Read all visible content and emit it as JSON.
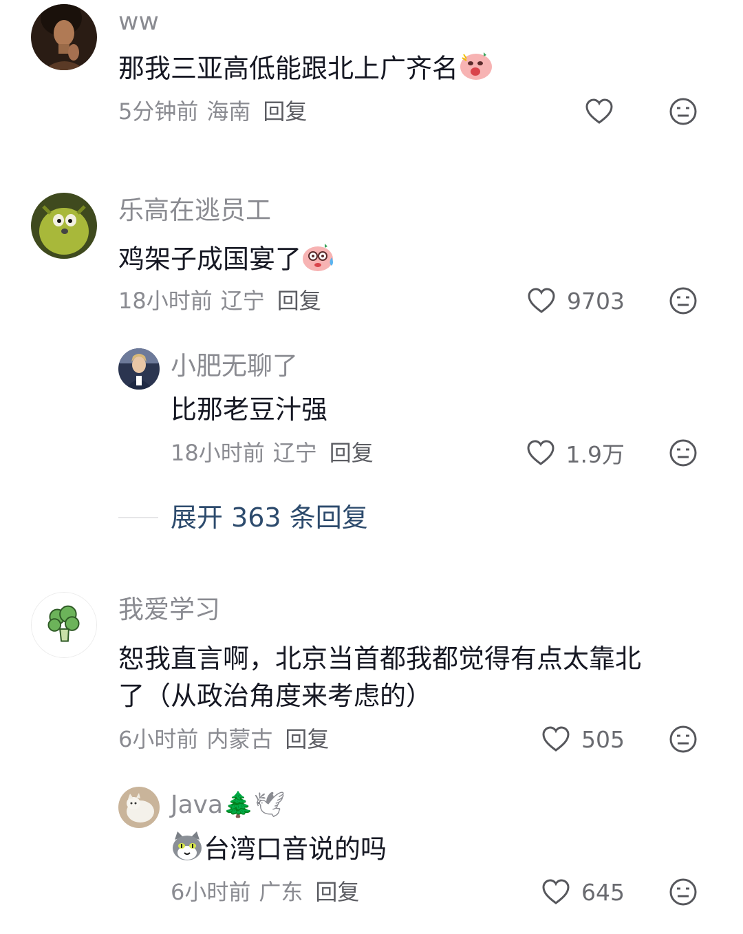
{
  "comments": [
    {
      "username": "ww",
      "text": "那我三亚高低能跟北上广齐名",
      "time": "5分钟前",
      "location": "海南",
      "reply_label": "回复",
      "likes": "",
      "avatar_icon": "woman-portrait-dark",
      "text_emoji": "angry-pig-emoji"
    },
    {
      "username": "乐高在逃员工",
      "text": "鸡架子成国宴了",
      "time": "18小时前",
      "location": "辽宁",
      "reply_label": "回复",
      "likes": "9703",
      "avatar_icon": "green-creature",
      "text_emoji": "sweat-pig-emoji",
      "replies": [
        {
          "username": "小肥无聊了",
          "text": "比那老豆汁强",
          "time": "18小时前",
          "location": "辽宁",
          "reply_label": "回复",
          "likes": "1.9万",
          "avatar_icon": "person-photo"
        }
      ],
      "expand_label": "展开 363 条回复"
    },
    {
      "username": "我爱学习",
      "text_line1": "恕我直言啊，北京当首都我都觉得有点太靠北",
      "text_line2": "了（从政治角度来考虑的）",
      "time": "6小时前",
      "location": "内蒙古",
      "reply_label": "回复",
      "likes": "505",
      "avatar_icon": "broccoli",
      "replies": [
        {
          "username": "Java",
          "username_emojis": "🌲🕊",
          "text": "台湾口音说的吗",
          "time": "6小时前",
          "location": "广东",
          "reply_label": "回复",
          "likes": "645",
          "avatar_icon": "cat-photo",
          "text_emoji": "cat-emoji"
        }
      ]
    }
  ],
  "colors": {
    "primary_text": "#161823",
    "secondary_text": "#8a8b91",
    "expand_link": "#2d4b6d",
    "background": "#ffffff"
  }
}
